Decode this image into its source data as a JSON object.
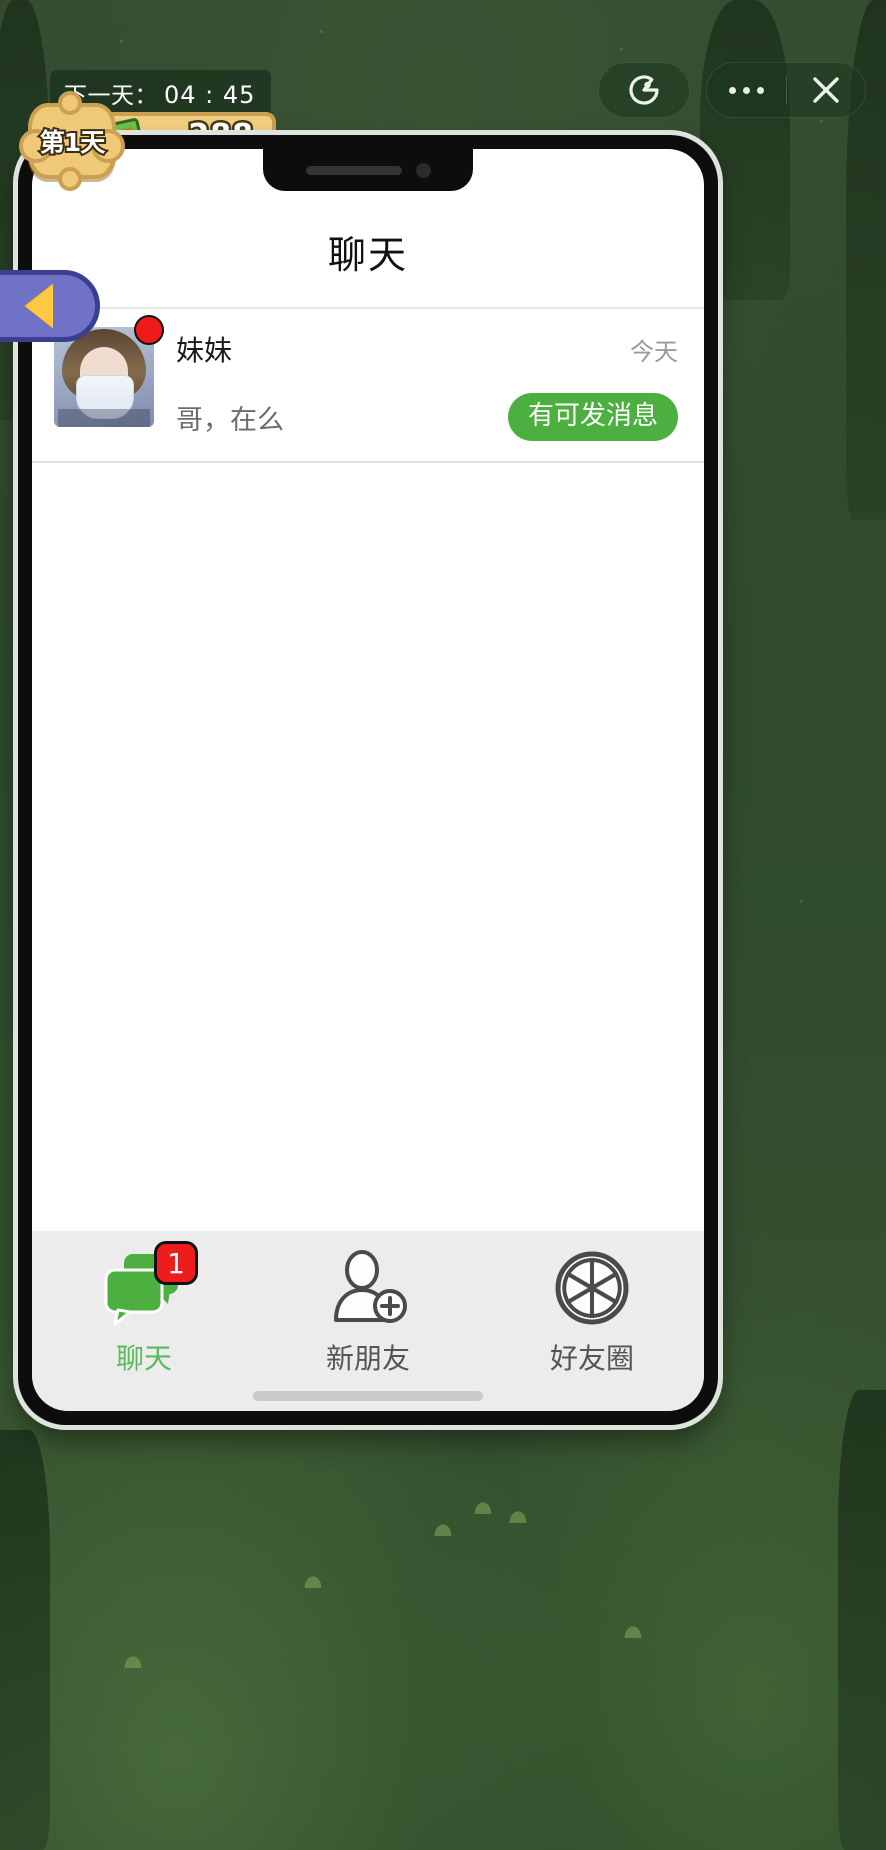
{
  "game_hud": {
    "timer_label": "下一天：",
    "timer_value": "04 : 45",
    "day_badge": "第1天",
    "money": "288",
    "money_icon": "cash-icon",
    "mini_program_icon": "mini-program-icon",
    "more_icon": "more-dots-icon",
    "close_icon": "close-icon",
    "back_arrow_icon": "back-arrow-icon"
  },
  "colors": {
    "accent_green": "#4caf3f",
    "tab_active": "#5cb85c",
    "badge_red": "#ee1d1d",
    "hud_gold": "#f2cf80",
    "bg_green": "#2f4a2e",
    "back_tab_purple": "#6f72c6"
  },
  "phone": {
    "header": {
      "title": "聊天"
    },
    "chats": [
      {
        "name": "妹妹",
        "time": "今天",
        "message": "哥，在么",
        "action_label": "有可发消息",
        "has_unread": true,
        "avatar_name": "contact-avatar-meimei"
      }
    ],
    "tabs": [
      {
        "label": "聊天",
        "icon": "chat-bubbles-icon",
        "badge": "1",
        "active": true
      },
      {
        "label": "新朋友",
        "icon": "add-person-icon",
        "badge": "",
        "active": false
      },
      {
        "label": "好友圈",
        "icon": "camera-shutter-icon",
        "badge": "",
        "active": false
      }
    ]
  }
}
